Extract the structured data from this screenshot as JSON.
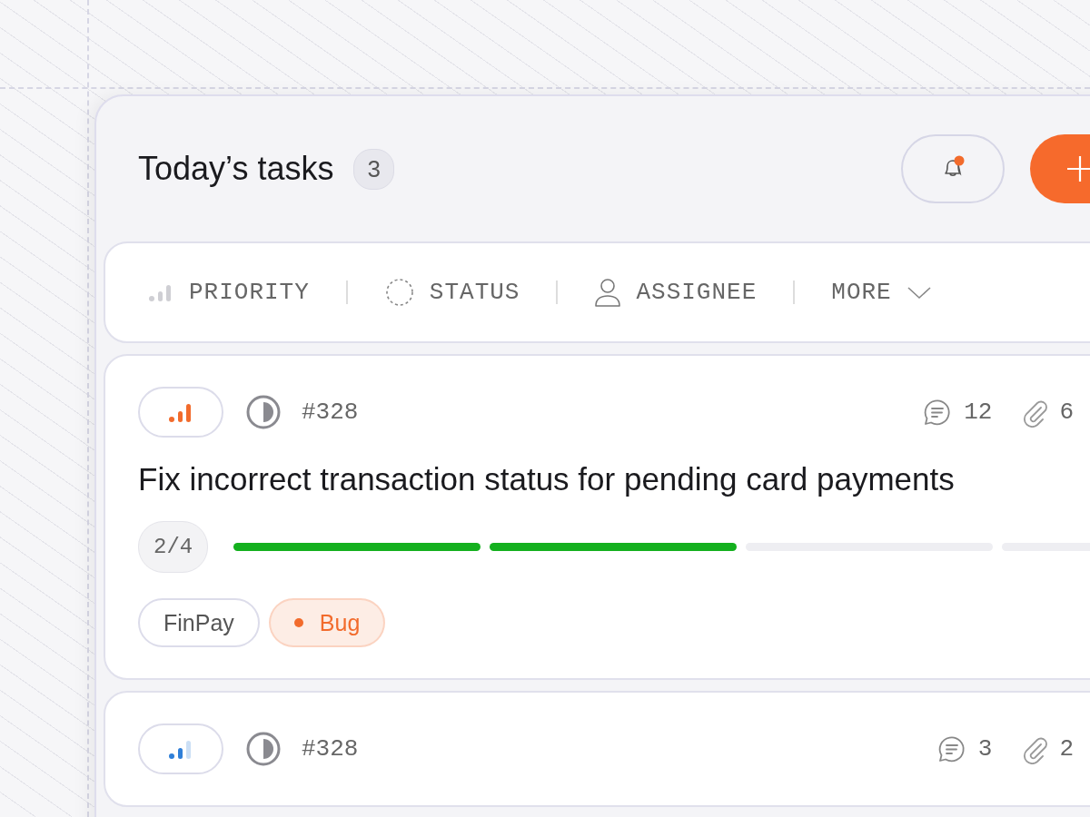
{
  "header": {
    "title": "Today’s tasks",
    "count": "3",
    "notifications": {
      "unread": true
    }
  },
  "filters": [
    {
      "kind": "priority",
      "label": "PRIORITY"
    },
    {
      "kind": "status",
      "label": "STATUS"
    },
    {
      "kind": "assignee",
      "label": "ASSIGNEE"
    },
    {
      "kind": "more",
      "label": "MORE"
    }
  ],
  "tasks": [
    {
      "priority": {
        "kind": "high",
        "color": "#f26b2c"
      },
      "status": {
        "kind": "half"
      },
      "id": "#328",
      "comments": "12",
      "attachments": "6",
      "title": "Fix incorrect transaction status for pending card payments",
      "progress": {
        "label": "2/4",
        "segments": [
          {
            "done": true
          },
          {
            "done": true
          },
          {
            "done": false
          },
          {
            "done": false
          }
        ]
      },
      "tags": [
        {
          "kind": "plain",
          "label": "FinPay"
        },
        {
          "kind": "dot",
          "label": "Bug",
          "color": "#f26b2c"
        }
      ]
    },
    {
      "priority": {
        "kind": "medium",
        "color": "#2f7fd8"
      },
      "status": {
        "kind": "half"
      },
      "id": "#328",
      "comments": "3",
      "attachments": "2"
    }
  ]
}
